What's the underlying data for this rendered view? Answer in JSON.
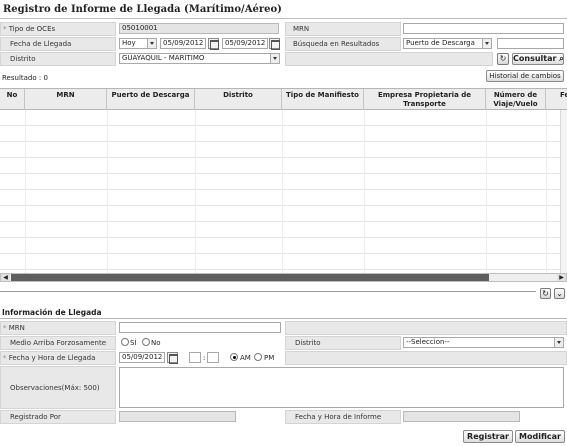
{
  "page": {
    "title": "Registro de Informe de Llegada (Marítimo/Aéreo)"
  },
  "search": {
    "tipo_oces_label": "Tipo de OCEs",
    "tipo_oces_value": "05010001",
    "mrn_label": "MRN",
    "mrn_value": "",
    "fecha_llegada_label": "Fecha de Llegada",
    "fecha_llegada_option": "Hoy",
    "fecha_desde": "05/09/2012",
    "fecha_hasta": "05/09/2012",
    "busqueda_label": "Búsqueda en Resultados",
    "busqueda_option": "Puerto de Descarga",
    "busqueda_value": "",
    "distrito_label": "Distrito",
    "distrito_value": "GUAYAQUIL - MARITIMO",
    "consultar_label": "Consultar",
    "historial_label": "Historial de cambios",
    "resultado_text": "Resultado : 0"
  },
  "grid": {
    "columns": [
      "No",
      "MRN",
      "Puerto de Descarga",
      "Distrito",
      "Tipo de Manifiesto",
      "Empresa Propietaria de Transporte",
      "Número de Viaje/Vuelo",
      "Fe"
    ]
  },
  "info": {
    "section_title": "Información de Llegada",
    "mrn_label": "MRN",
    "mrn_value": "",
    "medio_label": "Medio Arriba Forzosamente",
    "si_label": "SÍ",
    "no_label": "No",
    "distrito_label": "Distrito",
    "distrito_option": "--Seleccion--",
    "fecha_hora_label": "Fecha y Hora de Llegada",
    "fecha_value": "05/09/2012",
    "hora_value": "",
    "minuto_value": "",
    "hora_sep": ":",
    "am_label": "AM",
    "pm_label": "PM",
    "observaciones_label": "Observaciones(Máx: 500)",
    "observaciones_value": "",
    "registrado_label": "Registrado Por",
    "registrado_value": "",
    "fecha_informe_label": "Fecha y Hora de Informe",
    "fecha_informe_value": ""
  },
  "actions": {
    "registrar_label": "Registrar",
    "modificar_label": "Modificar"
  },
  "icons": {
    "required_marker": "*",
    "refresh": "refresh-icon",
    "collapse": "chevron-down-icon",
    "search": "search-icon",
    "calendar": "calendar-icon"
  }
}
